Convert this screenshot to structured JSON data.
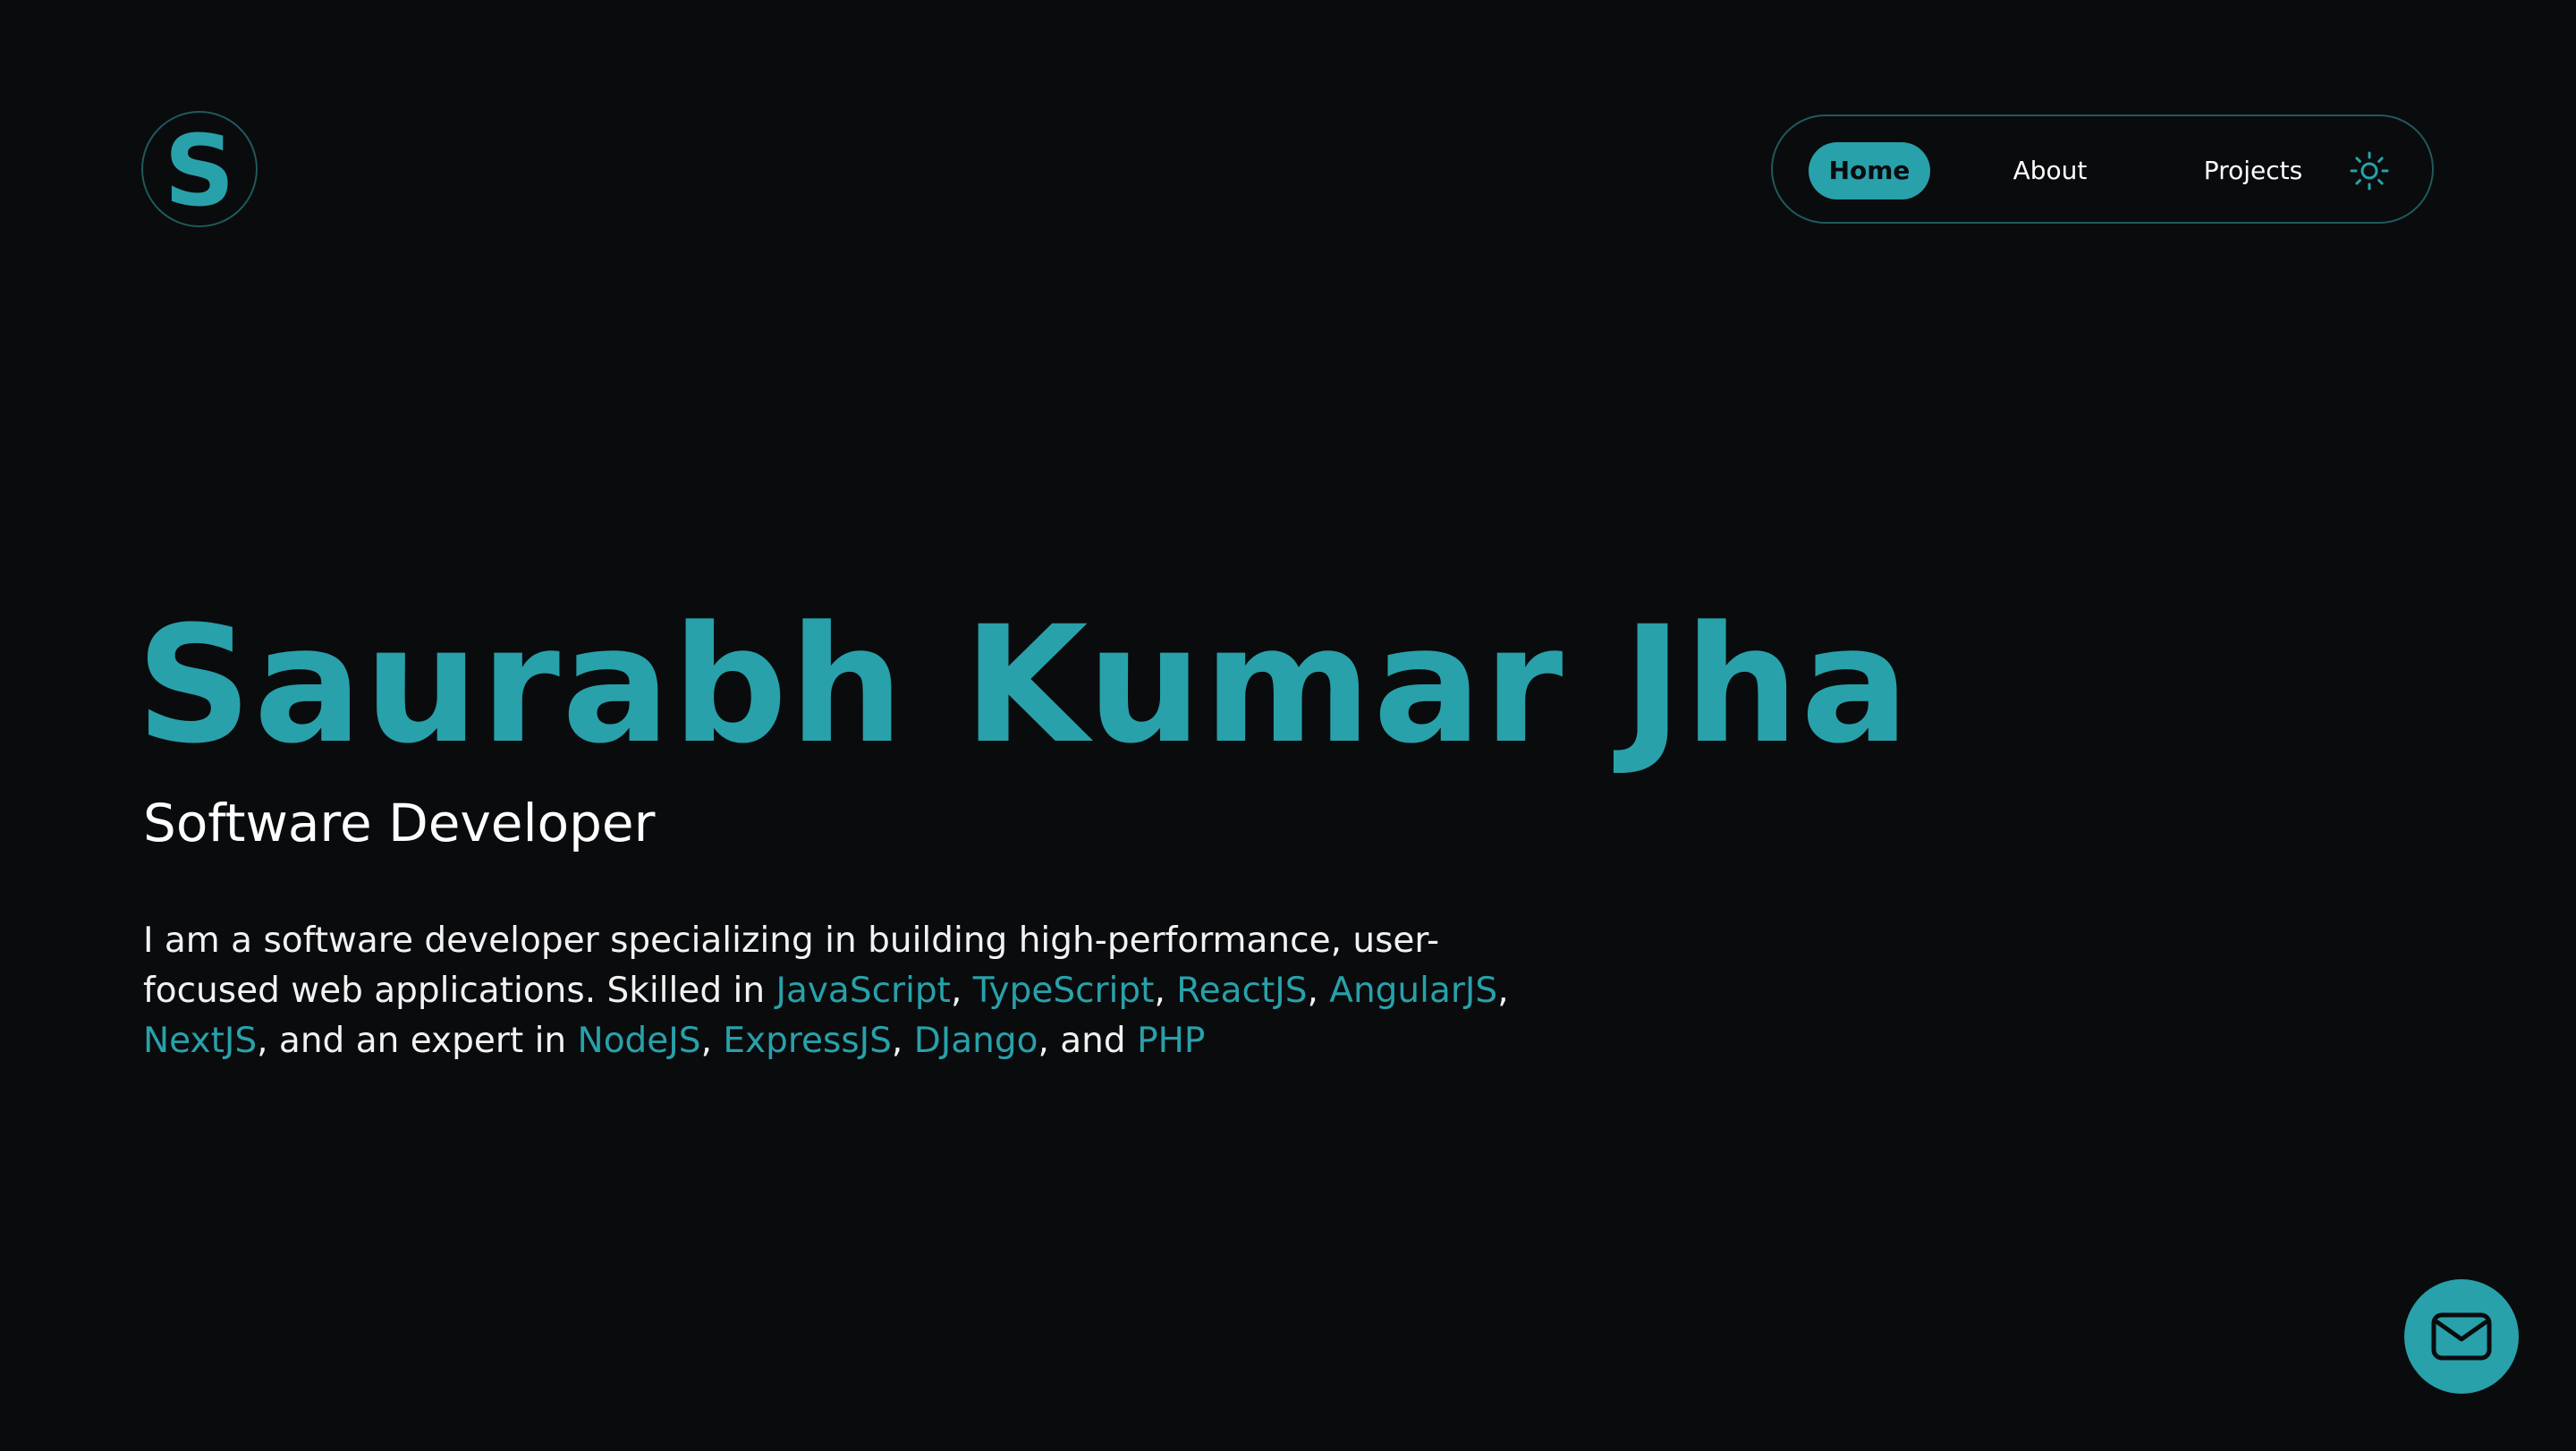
{
  "header": {
    "logo_letter": "S",
    "nav": {
      "home_label": "Home",
      "about_label": "About",
      "projects_label": "Projects",
      "active": "Home",
      "theme_icon": "sun-icon"
    }
  },
  "hero": {
    "name": "Saurabh Kumar Jha",
    "role": "Software Developer",
    "bio": {
      "intro": "I am a software developer specializing in building high-performance, user-focused web applications. Skilled in ",
      "skilled": [
        "JavaScript",
        "TypeScript",
        "ReactJS",
        "AngularJS",
        "NextJS"
      ],
      "expert_prefix": ", and an expert in ",
      "expert": [
        "NodeJS",
        "ExpressJS",
        "DJango",
        "PHP"
      ],
      "sep": ", ",
      "and": ", and "
    }
  },
  "fab": {
    "icon": "mail-icon"
  },
  "colors": {
    "background": "#0a0b0d",
    "accent": "#28a1aa",
    "border": "#1f5a5c",
    "text": "#ffffff"
  }
}
